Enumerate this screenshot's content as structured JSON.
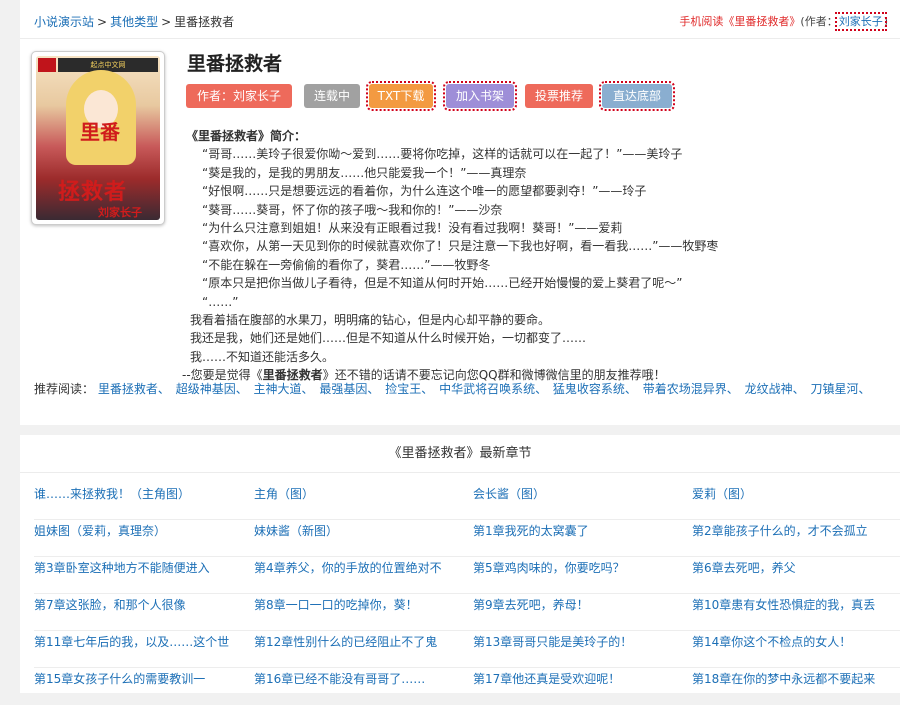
{
  "breadcrumb": {
    "home": "小说演示站",
    "sep1": ">",
    "category": "其他类型",
    "sep2": ">",
    "current": "里番拯救者"
  },
  "mobile": {
    "link": "手机阅读《里番拯救者》",
    "author_prefix": "(作者：",
    "author": "刘家长子",
    "author_suffix": ")"
  },
  "cover": {
    "badge": "",
    "site": "起点中文网",
    "title_top": "里番",
    "title_main": "拯救者",
    "author_text": "刘家长子"
  },
  "book": {
    "title": "里番拯救者"
  },
  "buttons": {
    "author": "作者：刘家长子",
    "serial": "连载中",
    "txt": "TXT下载",
    "shelf": "加入书架",
    "recommend": "投票推荐",
    "bottom": "直达底部"
  },
  "intro": {
    "heading": "《里番拯救者》简介：",
    "lines": [
      "“哥哥……美玲子很爱你呦～爱到……要将你吃掉，这样的话就可以在一起了！”——美玲子",
      "“葵是我的，是我的男朋友……他只能爱我一个！”——真理奈",
      "“好恨啊……只是想要远远的看着你，为什么连这个唯一的愿望都要剥夺！”——玲子",
      "“葵哥……葵哥，怀了你的孩子哦～我和你的！”——沙奈",
      "“为什么只注意到姐姐！从来没有正眼看过我！没有看过我啊！葵哥！”——爱莉",
      "“喜欢你，从第一天见到你的时候就喜欢你了！只是注意一下我也好啊，看一看我……”——牧野枣",
      "“不能在躲在一旁偷偷的看你了，葵君……”——牧野冬",
      "“原本只是把你当做儿子看待，但是不知道从何时开始……已经开始慢慢的爱上葵君了呢～”",
      "“……”"
    ],
    "lines2": [
      "我看着插在腹部的水果刀，明明痛的钻心，但是内心却平静的要命。",
      "我还是我，她们还是她们……但是不知道从什么时候开始，一切都变了……",
      "我……不知道还能活多久。"
    ],
    "last_pre": "--您要是觉得《",
    "last_bold": "里番拯救者",
    "last_post": "》还不错的话请不要忘记向您QQ群和微博微信里的朋友推荐哦！"
  },
  "recommend": {
    "label": "推荐阅读：",
    "items": [
      "里番拯救者、",
      "超级神基因、",
      "主神大道、",
      "最强基因、",
      "捡宝王、",
      "中华武将召唤系统、",
      "猛鬼收容系统、",
      "带着农场混异界、",
      "龙纹战神、",
      "刀镇星河、"
    ]
  },
  "chapters": {
    "heading": "《里番拯救者》最新章节",
    "rows": [
      [
        "谁……来拯救我！（主角图）",
        "主角（图）",
        "会长酱（图）",
        "爱莉（图）"
      ],
      [
        "姐妹图（爱莉，真理奈）",
        "妹妹酱（新图）",
        "第1章我死的太窝囊了",
        "第2章能孩子什么的，才不会孤立"
      ],
      [
        "第3章卧室这种地方不能随便进入",
        "第4章养父，你的手放的位置绝对不",
        "第5章鸡肉味的，你要吃吗？",
        "第6章去死吧，养父"
      ],
      [
        "第7章这张脸，和那个人很像",
        "第8章一口一口的吃掉你，葵！",
        "第9章去死吧，养母！",
        "第10章患有女性恐惧症的我，真丢"
      ],
      [
        "第11章七年后的我，以及……这个世",
        "第12章性别什么的已经阻止不了鬼",
        "第13章哥哥只能是美玲子的！",
        "第14章你这个不检点的女人！"
      ],
      [
        "第15章女孩子什么的需要教训一",
        "第16章已经不能没有哥哥了……",
        "第17章他还真是受欢迎呢！",
        "第18章在你的梦中永远都不要起来"
      ]
    ]
  }
}
